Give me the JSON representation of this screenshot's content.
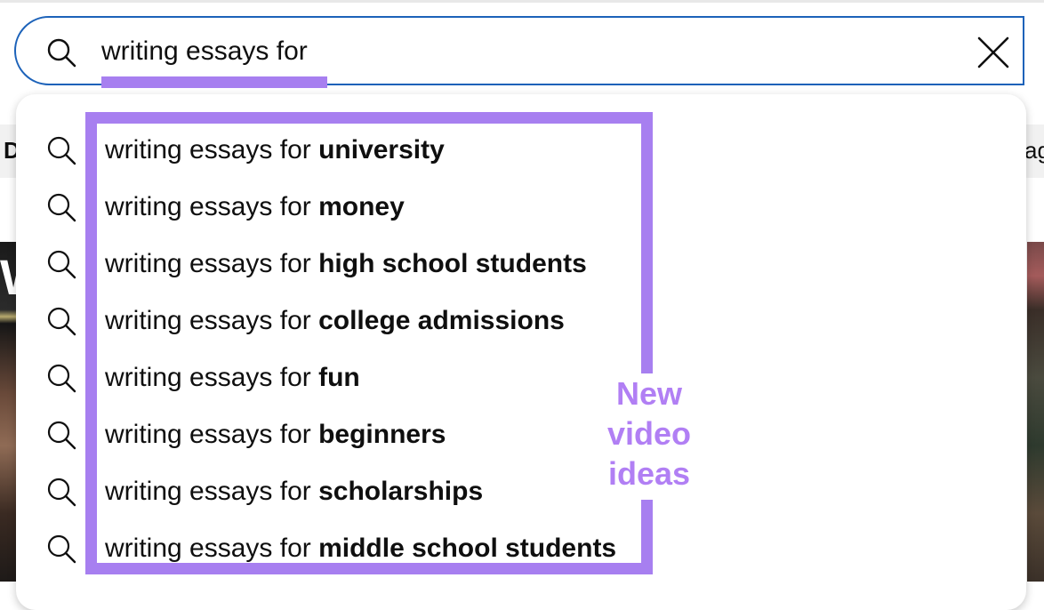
{
  "search": {
    "query": "writing essays for"
  },
  "suggestions": [
    {
      "prefix": "writing essays for ",
      "completion": "university"
    },
    {
      "prefix": "writing essays for ",
      "completion": "money"
    },
    {
      "prefix": "writing essays for ",
      "completion": "high school students"
    },
    {
      "prefix": "writing essays for ",
      "completion": "college admissions"
    },
    {
      "prefix": "writing essays for ",
      "completion": "fun"
    },
    {
      "prefix": "writing essays for ",
      "completion": "beginners"
    },
    {
      "prefix": "writing essays for ",
      "completion": "scholarships"
    },
    {
      "prefix": "writing essays for ",
      "completion": "middle school students"
    }
  ],
  "annotation": {
    "lines": [
      "New",
      "video",
      "ideas"
    ],
    "color": "#a77ff0"
  },
  "background": {
    "chip_left_fragment": "D",
    "chip_right_fragment": "ag"
  },
  "icons": {
    "search": "search-icon",
    "clear": "close-icon"
  },
  "colors": {
    "search_border": "#1c62b9",
    "highlight": "#a77ff0",
    "chip_bar": "#f1f1f1"
  }
}
